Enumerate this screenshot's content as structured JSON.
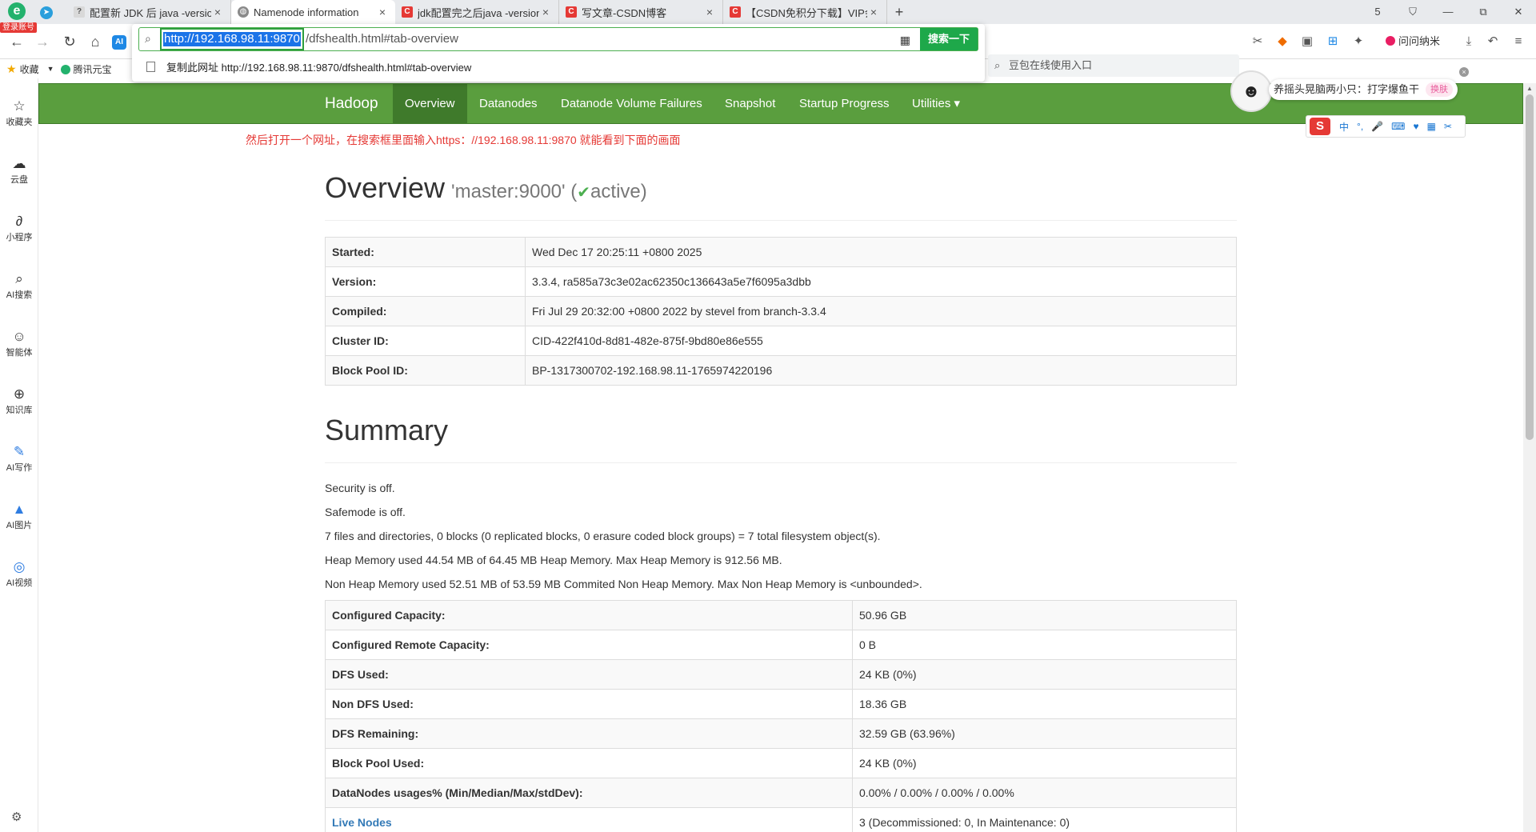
{
  "browser": {
    "login_badge": "登录账号",
    "tabs": [
      {
        "title": "配置新 JDK 后 java -version",
        "fav_color": "#d9d9d9",
        "fav_text": "?"
      },
      {
        "title": "Namenode information",
        "fav_color": "#8a8a8a",
        "fav_text": "◍"
      },
      {
        "title": "jdk配置完之后java -version",
        "fav_color": "#e53935",
        "fav_text": "C"
      },
      {
        "title": "写文章-CSDN博客",
        "fav_color": "#e53935",
        "fav_text": "C"
      },
      {
        "title": "【CSDN免积分下载】VIP会",
        "fav_color": "#e53935",
        "fav_text": "C"
      }
    ],
    "new_tab": "+",
    "window_controls": [
      "5",
      "⛉",
      "—",
      "⧉",
      "✕"
    ],
    "address": {
      "selected_text": "http://192.168.98.11:9870",
      "rest_text": "/dfshealth.html#tab-overview",
      "search_button": "搜索一下",
      "suggestion": "复制此网址 http://192.168.98.11:9870/dfshealth.html#tab-overview"
    },
    "right_search_placeholder": "豆包在线使用入口",
    "ask_button": "问问纳米",
    "bookmarks": {
      "favorites": "收藏",
      "tencent": "腾讯元宝"
    }
  },
  "sidebar": {
    "items": [
      {
        "icon": "☆",
        "label": "收藏夹"
      },
      {
        "icon": "☁",
        "label": "云盘"
      },
      {
        "icon": "∂",
        "label": "小程序"
      },
      {
        "icon": "⌕",
        "label": "AI搜索"
      },
      {
        "icon": "☺",
        "label": "智能体"
      },
      {
        "icon": "⊕",
        "label": "知识库"
      },
      {
        "icon": "✎",
        "label": "AI写作"
      },
      {
        "icon": "▲",
        "label": "AI图片"
      },
      {
        "icon": "◎",
        "label": "AI视频"
      }
    ],
    "settings_icon": "⚙"
  },
  "hadoop": {
    "brand": "Hadoop",
    "nav": [
      "Overview",
      "Datanodes",
      "Datanode Volume Failures",
      "Snapshot",
      "Startup Progress",
      "Utilities ▾"
    ],
    "active_nav": "Overview"
  },
  "annotation": "然后打开一个网址，在搜索框里面输入https：//192.168.98.11:9870 就能看到下面的画面",
  "overview": {
    "title": "Overview",
    "host": "'master:9000'",
    "status_open": "(",
    "status_check": "✔",
    "status_text": "active)",
    "rows": [
      {
        "key": "Started:",
        "value": "Wed Dec 17 20:25:11 +0800 2025"
      },
      {
        "key": "Version:",
        "value": "3.3.4, ra585a73c3e02ac62350c136643a5e7f6095a3dbb"
      },
      {
        "key": "Compiled:",
        "value": "Fri Jul 29 20:32:00 +0800 2022 by stevel from branch-3.3.4"
      },
      {
        "key": "Cluster ID:",
        "value": "CID-422f410d-8d81-482e-875f-9bd80e86e555"
      },
      {
        "key": "Block Pool ID:",
        "value": "BP-1317300702-192.168.98.11-1765974220196"
      }
    ]
  },
  "summary": {
    "title": "Summary",
    "lines": [
      "Security is off.",
      "Safemode is off.",
      "7 files and directories, 0 blocks (0 replicated blocks, 0 erasure coded block groups) = 7 total filesystem object(s).",
      "Heap Memory used 44.54 MB of 64.45 MB Heap Memory. Max Heap Memory is 912.56 MB.",
      "Non Heap Memory used 52.51 MB of 53.59 MB Commited Non Heap Memory. Max Non Heap Memory is <unbounded>."
    ],
    "rows": [
      {
        "key": "Configured Capacity:",
        "value": "50.96 GB"
      },
      {
        "key": "Configured Remote Capacity:",
        "value": "0 B"
      },
      {
        "key": "DFS Used:",
        "value": "24 KB (0%)"
      },
      {
        "key": "Non DFS Used:",
        "value": "18.36 GB"
      },
      {
        "key": "DFS Remaining:",
        "value": "32.59 GB (63.96%)"
      },
      {
        "key": "Block Pool Used:",
        "value": "24 KB (0%)"
      },
      {
        "key": "DataNodes usages% (Min/Median/Max/stdDev):",
        "value": "0.00% / 0.00% / 0.00% / 0.00%"
      },
      {
        "key": "Live Nodes",
        "value": "3 (Decommissioned: 0, In Maintenance: 0)",
        "link": true
      }
    ]
  },
  "widget": {
    "text": "养摇头晃脑两小只：打字爆鱼干",
    "skin_button": "换肤",
    "ime_items": [
      "中",
      "°,",
      "🎤",
      "⌨",
      "♥",
      "▦",
      "✂"
    ]
  }
}
